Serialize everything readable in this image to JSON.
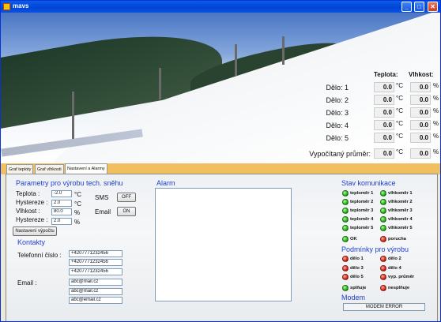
{
  "window": {
    "title": "mavs",
    "min": "_",
    "max": "□",
    "close": "✕"
  },
  "readings": {
    "col_temp": "Teplota:",
    "col_humidity": "Vlhkost:",
    "unit_temp": "°C",
    "unit_humidity": "%",
    "rows": [
      {
        "label": "Dělo: 1",
        "temp": "0.0",
        "humidity": "0.0"
      },
      {
        "label": "Dělo: 2",
        "temp": "0.0",
        "humidity": "0.0"
      },
      {
        "label": "Dělo: 3",
        "temp": "0.0",
        "humidity": "0.0"
      },
      {
        "label": "Dělo: 4",
        "temp": "0.0",
        "humidity": "0.0"
      },
      {
        "label": "Dělo: 5",
        "temp": "0.0",
        "humidity": "0.0"
      }
    ],
    "computed_label": "Vypočítaný průměr:",
    "computed_temp": "0.0",
    "computed_humidity": "0.0"
  },
  "tabs": [
    "Graf teploty",
    "Graf vlhkosti",
    "Nastavení a Alarmy"
  ],
  "params": {
    "title": "Parametry pro výrobu tech. sněhu",
    "teplota_label": "Teplota :",
    "teplota_value": "-2.0",
    "teplota_unit": "°C",
    "hyst1_label": "Hystereze :",
    "hyst1_value": "2.0",
    "hyst1_unit": "°C",
    "vlhkost_label": "Vlhkost :",
    "vlhkost_value": "80.0",
    "vlhkost_unit": "%",
    "hyst2_label": "Hystereze :",
    "hyst2_value": "2.0",
    "hyst2_unit": "%",
    "sms_label": "SMS",
    "sms_button": "OFF",
    "email_label": "Email",
    "email_button": "ON",
    "nastaveni_button": "Nastavení výpočtu"
  },
  "contacts": {
    "title": "Kontakty",
    "phone_label": "Telefonní číslo :",
    "phones": [
      "+4207771232456",
      "+4207771232456",
      "+4207771232456"
    ],
    "email_label": "Email :",
    "emails": [
      "abc@mail.cz",
      "abc@mail.cz",
      "abc@email.cz"
    ]
  },
  "alarm": {
    "title": "Alarm",
    "text": ""
  },
  "comm": {
    "title": "Stav komunikace",
    "left": [
      "teploměr 1",
      "teploměr 2",
      "teploměr 3",
      "teploměr 4",
      "teploměr 5"
    ],
    "right": [
      "vlhkoměr 1",
      "vlhkoměr 2",
      "vlhkoměr 3",
      "vlhkoměr 4",
      "vlhkoměr 5"
    ],
    "ok": "OK",
    "fault": "porucha"
  },
  "production": {
    "title": "Podmínky pro výrobu",
    "left": [
      "dělo 1",
      "dělo 3",
      "dělo 5"
    ],
    "right": [
      "dělo 2",
      "dělo 4",
      "vyp. průměr"
    ],
    "meets": "splňuje",
    "not_meets": "nesplňuje"
  },
  "modem": {
    "title": "Modem",
    "status": "MODEM ERROR"
  },
  "colors": {
    "accent": "#1f3fd0",
    "titlebar": "#0054e3",
    "tab_strip": "#f0c060",
    "ok": "#22b01a",
    "error": "#d4261a"
  }
}
